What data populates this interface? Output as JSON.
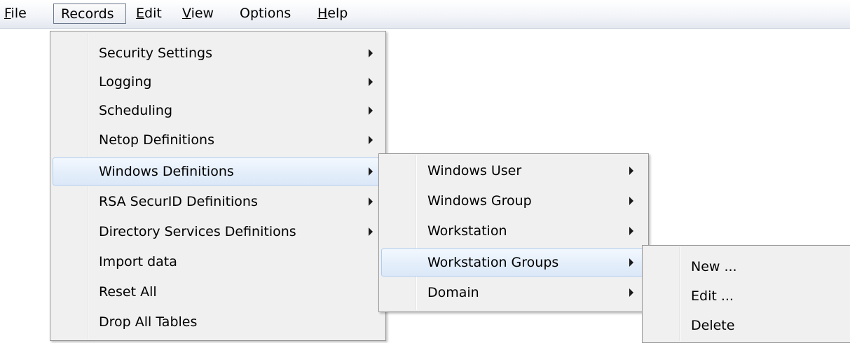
{
  "menubar": {
    "items": [
      {
        "label": "File",
        "mnemonic": "F",
        "rest": "ile"
      },
      {
        "label": "Records"
      },
      {
        "label": "Edit",
        "mnemonic": "E",
        "rest": "dit"
      },
      {
        "label": "View",
        "mnemonic": "V",
        "rest": "iew"
      },
      {
        "label": "Options"
      },
      {
        "label": "Help",
        "mnemonic": "H",
        "rest": "elp"
      }
    ]
  },
  "records_menu": {
    "items": [
      {
        "label": "Security Settings",
        "submenu": true
      },
      {
        "label": "Logging",
        "submenu": true
      },
      {
        "label": "Scheduling",
        "submenu": true
      },
      {
        "label": "Netop Definitions",
        "submenu": true
      },
      {
        "label": "Windows Definitions",
        "submenu": true,
        "highlighted": true
      },
      {
        "label": "RSA SecurID Definitions",
        "submenu": true
      },
      {
        "label": "Directory Services Definitions",
        "submenu": true
      },
      {
        "label": "Import data",
        "submenu": false
      },
      {
        "label": "Reset All",
        "submenu": false
      },
      {
        "label": "Drop All Tables",
        "submenu": false
      }
    ]
  },
  "windows_definitions_menu": {
    "items": [
      {
        "label": "Windows User",
        "submenu": true
      },
      {
        "label": "Windows Group",
        "submenu": true
      },
      {
        "label": "Workstation",
        "submenu": true
      },
      {
        "label": "Workstation Groups",
        "submenu": true,
        "highlighted": true
      },
      {
        "label": "Domain",
        "submenu": true
      }
    ]
  },
  "workstation_groups_menu": {
    "items": [
      {
        "label": "New ..."
      },
      {
        "label": "Edit ..."
      },
      {
        "label": "Delete"
      }
    ]
  },
  "icons": {
    "submenu_arrow": "chevron-right-icon"
  },
  "colors": {
    "highlight_border": "#aeccf1",
    "menu_background": "#f0f0f0",
    "menu_border": "#979797"
  }
}
